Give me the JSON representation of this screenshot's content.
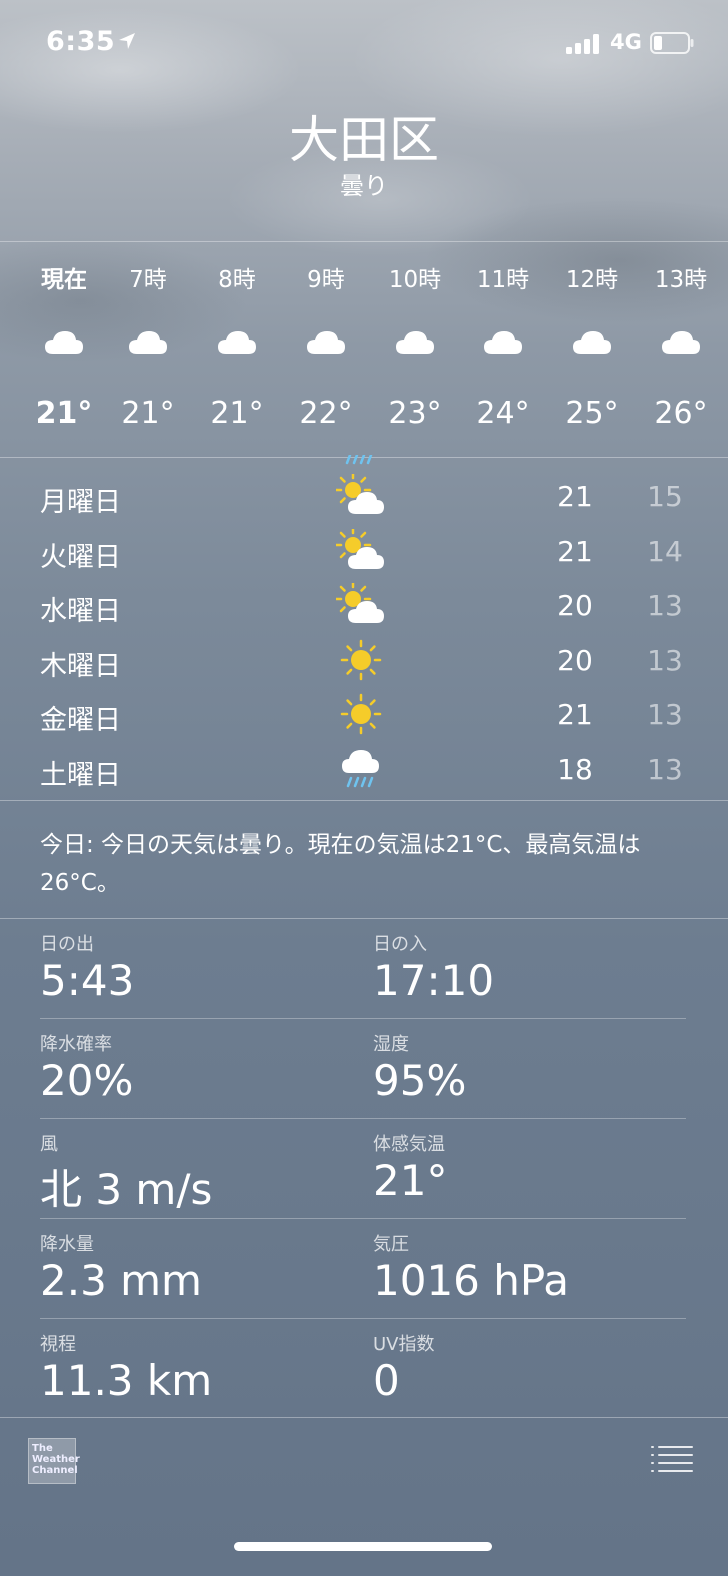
{
  "status_bar": {
    "time": "6:35",
    "network": "4G",
    "icons": [
      "location-arrow-icon",
      "signal-bars-icon",
      "battery-icon"
    ]
  },
  "header": {
    "city": "大田区",
    "condition": "曇り"
  },
  "hourly": [
    {
      "label": "現在",
      "temp": "21°",
      "icon": "cloud-icon"
    },
    {
      "label": "7時",
      "temp": "21°",
      "icon": "cloud-icon"
    },
    {
      "label": "8時",
      "temp": "21°",
      "icon": "cloud-icon"
    },
    {
      "label": "9時",
      "temp": "22°",
      "icon": "cloud-icon"
    },
    {
      "label": "10時",
      "temp": "23°",
      "icon": "cloud-icon"
    },
    {
      "label": "11時",
      "temp": "24°",
      "icon": "cloud-icon"
    },
    {
      "label": "12時",
      "temp": "25°",
      "icon": "cloud-icon"
    },
    {
      "label": "13時",
      "temp": "26°",
      "icon": "cloud-icon"
    }
  ],
  "daily": [
    {
      "day": "月曜日",
      "icon": "partly-sunny-icon",
      "high": "21",
      "low": "15"
    },
    {
      "day": "火曜日",
      "icon": "partly-sunny-icon",
      "high": "21",
      "low": "14"
    },
    {
      "day": "水曜日",
      "icon": "partly-sunny-icon",
      "high": "20",
      "low": "13"
    },
    {
      "day": "木曜日",
      "icon": "sun-icon",
      "high": "20",
      "low": "13"
    },
    {
      "day": "金曜日",
      "icon": "sun-icon",
      "high": "21",
      "low": "13"
    },
    {
      "day": "土曜日",
      "icon": "rain-cloud-icon",
      "high": "18",
      "low": "13"
    }
  ],
  "summary": "今日: 今日の天気は曇り。現在の気温は21°C、最高気温は26°C。",
  "details": [
    {
      "left_label": "日の出",
      "left_value": "5:43",
      "right_label": "日の入",
      "right_value": "17:10"
    },
    {
      "left_label": "降水確率",
      "left_value": "20%",
      "right_label": "湿度",
      "right_value": "95%"
    },
    {
      "left_label": "風",
      "left_value": "北 3 m/s",
      "right_label": "体感気温",
      "right_value": "21°"
    },
    {
      "left_label": "降水量",
      "left_value": "2.3 mm",
      "right_label": "気圧",
      "right_value": "1016 hPa"
    },
    {
      "left_label": "視程",
      "left_value": "11.3 km",
      "right_label": "UV指数",
      "right_value": "0"
    }
  ],
  "footer": {
    "logo_text": "The Weather Channel",
    "icons": [
      "weather-channel-logo",
      "list-icon"
    ]
  },
  "colors": {
    "sun": "#f5cc2a",
    "rain": "#6fc3ef",
    "text": "#ffffff"
  }
}
